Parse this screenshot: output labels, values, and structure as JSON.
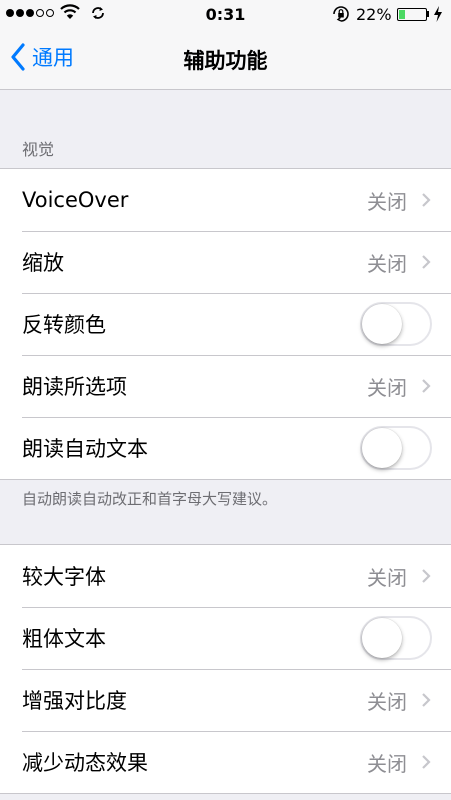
{
  "status_bar": {
    "time": "0:31",
    "battery_percent": "22%",
    "battery_level": 0.22,
    "icons": [
      "signal-dots-icon",
      "wifi-icon",
      "sync-icon",
      "orientation-lock-icon",
      "battery-icon",
      "charging-bolt-icon"
    ]
  },
  "nav": {
    "back_label": "通用",
    "title": "辅助功能",
    "accent_color": "#007aff"
  },
  "sections": [
    {
      "header": "视觉",
      "rows": [
        {
          "label": "VoiceOver",
          "value": "关闭",
          "type": "disclosure"
        },
        {
          "label": "缩放",
          "value": "关闭",
          "type": "disclosure"
        },
        {
          "label": "反转颜色",
          "type": "toggle",
          "on": false
        },
        {
          "label": "朗读所选项",
          "value": "关闭",
          "type": "disclosure"
        },
        {
          "label": "朗读自动文本",
          "type": "toggle",
          "on": false
        }
      ],
      "footer": "自动朗读自动改正和首字母大写建议。"
    },
    {
      "rows": [
        {
          "label": "较大字体",
          "value": "关闭",
          "type": "disclosure"
        },
        {
          "label": "粗体文本",
          "type": "toggle",
          "on": false
        },
        {
          "label": "增强对比度",
          "value": "关闭",
          "type": "disclosure"
        },
        {
          "label": "减少动态效果",
          "value": "关闭",
          "type": "disclosure"
        }
      ]
    }
  ]
}
